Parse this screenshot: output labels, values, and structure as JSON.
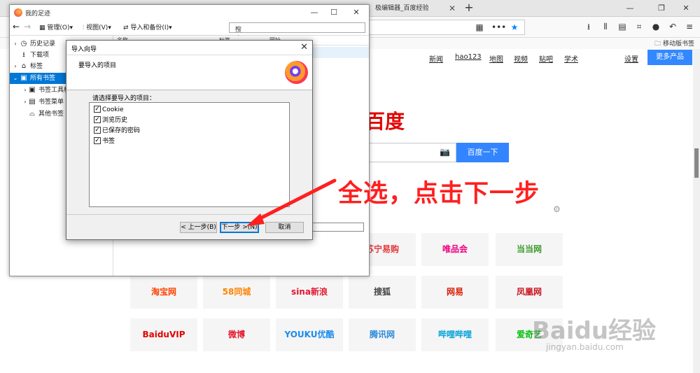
{
  "browser": {
    "tabs": [
      {
        "label": "极编辑器_百度经验"
      }
    ],
    "mobile_bookmarks": "移动版书签"
  },
  "baidu": {
    "top_links": [
      "新闻",
      "hao123",
      "地图",
      "视频",
      "贴吧",
      "学术"
    ],
    "settings": "设置",
    "more_products": "更多产品",
    "logo": "百度",
    "search_button": "百度一下",
    "tiles": [
      {
        "label": "苏宁易购",
        "color": "#e4393c"
      },
      {
        "label": "唯品会",
        "color": "#f10180"
      },
      {
        "label": "当当网",
        "color": "#3c9a2b"
      },
      {
        "label": "淘宝网",
        "color": "#ff4400"
      },
      {
        "label": "58同城",
        "color": "#ff8200"
      },
      {
        "label": "sina新浪",
        "color": "#e6162d"
      },
      {
        "label": "搜狐",
        "color": "#444444"
      },
      {
        "label": "网易",
        "color": "#d81e06"
      },
      {
        "label": "凤凰网",
        "color": "#c9151e"
      },
      {
        "label": "BaiduVIP",
        "color": "#e10601"
      },
      {
        "label": "微博",
        "color": "#e6162d"
      },
      {
        "label": "YOUKU优酷",
        "color": "#1b8ceb"
      },
      {
        "label": "腾讯网",
        "color": "#2c8ad8"
      },
      {
        "label": "哔哩哔哩",
        "color": "#00a1d6"
      },
      {
        "label": "爱奇艺",
        "color": "#00be06"
      }
    ]
  },
  "library": {
    "title": "我的足迹",
    "toolbar": {
      "organize": "管理(O)",
      "views": "视图(V)",
      "import_backup": "导入和备份(I)",
      "search_placeholder": "搜索书签"
    },
    "columns": [
      "名称",
      "标签",
      "网址"
    ],
    "tree": [
      {
        "label": "历史记录",
        "icon": "clock-icon"
      },
      {
        "label": "下载项",
        "icon": "download-icon"
      },
      {
        "label": "标签",
        "icon": "tag-icon"
      },
      {
        "label": "所有书签",
        "icon": "bookmark-icon"
      },
      {
        "label": "书签工具栏",
        "icon": "toolbar-icon"
      },
      {
        "label": "书签菜单",
        "icon": "menu-icon"
      },
      {
        "label": "其他书签",
        "icon": "folder-icon"
      }
    ]
  },
  "wizard": {
    "title": "导入向导",
    "heading": "要导入的项目",
    "prompt": "请选择要导入的项目：",
    "items": [
      {
        "label": "Cookie",
        "checked": true
      },
      {
        "label": "浏览历史",
        "checked": true
      },
      {
        "label": "已保存的密码",
        "checked": true
      },
      {
        "label": "书签",
        "checked": true
      }
    ],
    "back_button": "< 上一步(B)",
    "next_button": "下一步 >(N)",
    "cancel_button": "取消"
  },
  "annotation": "全选，点击下一步",
  "watermark": {
    "brand": "Baidu经验",
    "url": "jingyan.baidu.com"
  },
  "colors": {
    "annotation_red": "#ff1f1f",
    "accent_blue": "#3385ff",
    "selection_blue": "#0078d7"
  }
}
